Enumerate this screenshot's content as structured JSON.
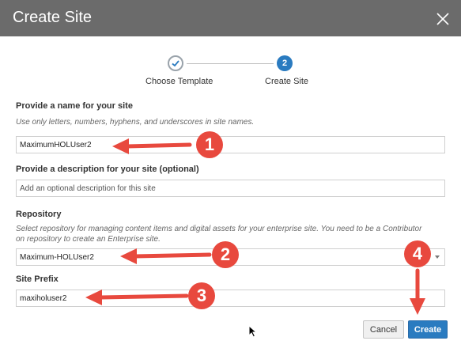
{
  "dialog": {
    "title": "Create Site"
  },
  "stepper": {
    "steps": [
      {
        "label": "Choose Template",
        "state": "completed"
      },
      {
        "label": "Create Site",
        "number": "2",
        "state": "active"
      }
    ]
  },
  "form": {
    "name": {
      "label": "Provide a name for your site",
      "hint": "Use only letters, numbers, hyphens, and underscores in site names.",
      "value": "MaximumHOLUser2"
    },
    "description": {
      "label": "Provide a description for your site (optional)",
      "placeholder": "Add an optional description for this site"
    },
    "repository": {
      "label": "Repository",
      "hint_line1": "Select repository for managing content items and digital assets for your enterprise site. You need to be a Contributor",
      "hint_line2": "on repository to create an Enterprise site.",
      "value": "Maximum-HOLUser2"
    },
    "site_prefix": {
      "label": "Site Prefix",
      "value": "maxiholuser2"
    }
  },
  "buttons": {
    "cancel": "Cancel",
    "create": "Create"
  },
  "annotations": {
    "badges": [
      "1",
      "2",
      "3",
      "4"
    ],
    "color": "#e8493e"
  },
  "colors": {
    "titlebar": "#6b6b6b",
    "accent": "#2a7bc0"
  }
}
